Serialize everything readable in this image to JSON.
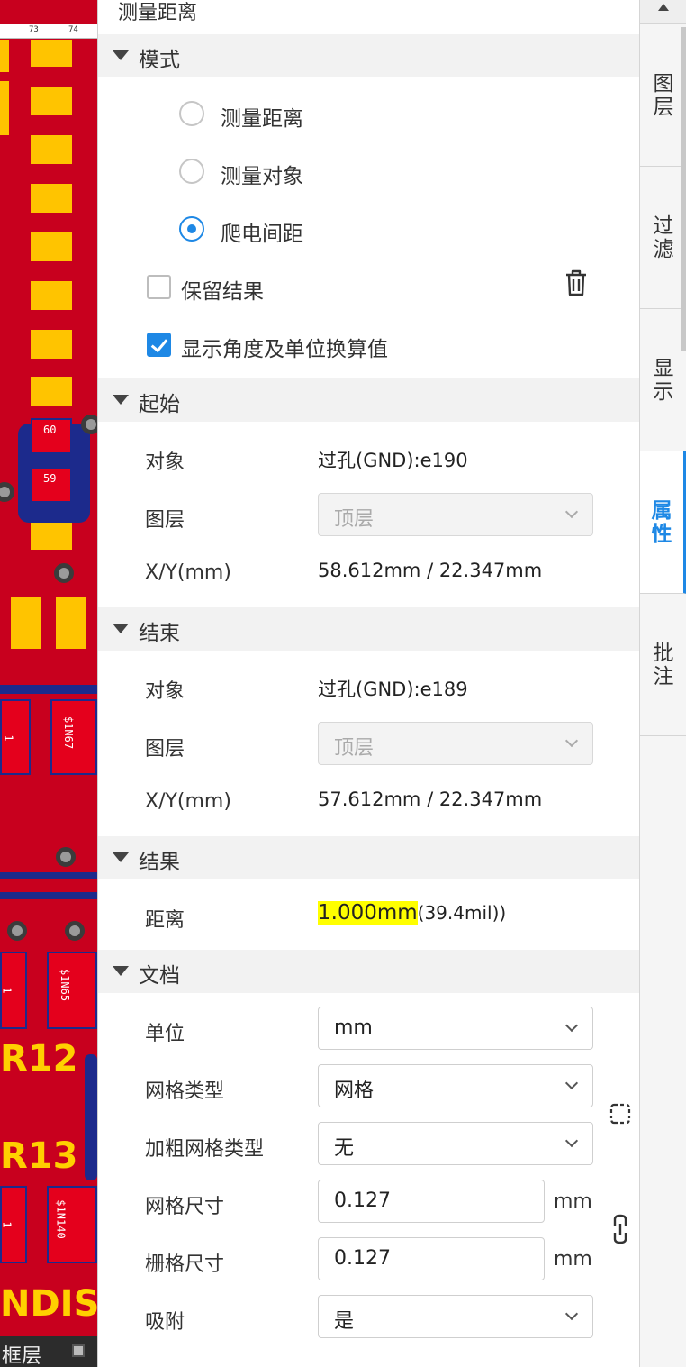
{
  "canvas": {
    "ruler_ticks": [
      "73",
      "74"
    ],
    "silk_labels": [
      "R12",
      "R13",
      "NDIS"
    ],
    "pad_labels": [
      "60",
      "59",
      "1",
      "$1N67",
      "1",
      "$1N65",
      "1",
      "$1N140"
    ],
    "status_label": "框层"
  },
  "panel": {
    "title": "测量距离",
    "mode": {
      "header": "模式",
      "options": [
        {
          "label": "测量距离",
          "selected": false
        },
        {
          "label": "测量对象",
          "selected": false
        },
        {
          "label": "爬电间距",
          "selected": true
        }
      ],
      "keep_result": {
        "label": "保留结果",
        "checked": false
      },
      "show_angle": {
        "label": "显示角度及单位换算值",
        "checked": true
      }
    },
    "start": {
      "header": "起始",
      "object_label": "对象",
      "object_value": "过孔(GND):e190",
      "layer_label": "图层",
      "layer_value": "顶层",
      "xy_label": "X/Y(mm)",
      "xy_value": "58.612mm / 22.347mm"
    },
    "end": {
      "header": "结束",
      "object_label": "对象",
      "object_value": "过孔(GND):e189",
      "layer_label": "图层",
      "layer_value": "顶层",
      "xy_label": "X/Y(mm)",
      "xy_value": "57.612mm / 22.347mm"
    },
    "result": {
      "header": "结果",
      "distance_label": "距离",
      "distance_value": "1.000mm",
      "distance_alt": "(39.4mil))"
    },
    "document": {
      "header": "文档",
      "unit_label": "单位",
      "unit_value": "mm",
      "grid_type_label": "网格类型",
      "grid_type_value": "网格",
      "bold_grid_label": "加粗网格类型",
      "bold_grid_value": "无",
      "grid_size_label": "网格尺寸",
      "grid_size_value": "0.127",
      "grid_size_unit": "mm",
      "snap_size_label": "栅格尺寸",
      "snap_size_value": "0.127",
      "snap_size_unit": "mm",
      "snap_label": "吸附",
      "snap_value": "是"
    },
    "colors": {
      "accent": "#1e88e5",
      "highlight": "#ffff00"
    }
  },
  "tabs": [
    {
      "label": "图层",
      "active": false
    },
    {
      "label": "过滤",
      "active": false
    },
    {
      "label": "显示",
      "active": false
    },
    {
      "label": "属性",
      "active": true
    },
    {
      "label": "批注",
      "active": false
    }
  ]
}
